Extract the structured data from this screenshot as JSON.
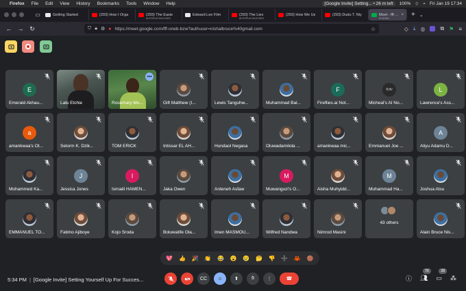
{
  "menubar": {
    "app": "Firefox",
    "items": [
      "File",
      "Edit",
      "View",
      "History",
      "Bookmarks",
      "Tools",
      "Window",
      "Help"
    ],
    "notification": "[Google Invite] Setting... • 26 m left",
    "battery": "100%",
    "datetime": "Fri Jan 19  17:34"
  },
  "tabs": [
    {
      "title": "Getting Started",
      "favicon": "doc-icon"
    },
    {
      "title": "(293) How I Orga",
      "favicon": "youtube-icon"
    },
    {
      "title": "(293) The Easie",
      "favicon": "youtube-icon",
      "sub": "AUTOPLAY BLOCKED"
    },
    {
      "title": "Edward Lee Film",
      "favicon": "doc-icon"
    },
    {
      "title": "(293) The Lies",
      "favicon": "youtube-icon",
      "sub": "AUTOPLAY BLOCKED"
    },
    {
      "title": "(293) How We Us",
      "favicon": "youtube-icon"
    },
    {
      "title": "(293) Dudu T. Niy",
      "favicon": "youtube-icon"
    },
    {
      "title": "Meet - fff-oneb-",
      "favicon": "meet-icon",
      "sub": "PLAYING",
      "active": true
    }
  ],
  "navbar": {
    "url": "https://meet.google.com/fff-oneb-bzw?authuser=nishalbruce%40gmail.com"
  },
  "participants": [
    {
      "name": "Emerald Akhau...",
      "initial": "E",
      "color": "#1e6b4f"
    },
    {
      "name": "Lalu Etchie",
      "video": "v1"
    },
    {
      "name": "Rosemary Mo...",
      "video": "v2",
      "speaking": true
    },
    {
      "name": "Gift Matthew (I...",
      "photo": "photo"
    },
    {
      "name": "Lewis Tanguhw...",
      "photo": "photo2"
    },
    {
      "name": "Muhammad Bal...",
      "photo": "photo4"
    },
    {
      "name": "Fireflies.ai Not...",
      "initial": "F",
      "color": "#1a6b5a"
    },
    {
      "name": "Micheal's AI No...",
      "logo": "tl;dv"
    },
    {
      "name": "Lawrence's Ass...",
      "initial": "L",
      "color": "#7cb342"
    },
    {
      "name": "amankwaa's Ot...",
      "initial": "a",
      "color": "#e8590c"
    },
    {
      "name": "Selorm K. Dzik...",
      "photo": "photo3"
    },
    {
      "name": "TOM ERICK",
      "photo": "photo2"
    },
    {
      "name": "Intissar EL AH...",
      "photo": "photo3"
    },
    {
      "name": "Hundaol Negasa",
      "photo": "photo4"
    },
    {
      "name": "Oluwadamilola ...",
      "photo": "photo"
    },
    {
      "name": "amankwaa mic...",
      "photo": "photo2"
    },
    {
      "name": "Emmanuel Joe ...",
      "photo": "photo3"
    },
    {
      "name": "Aliyu Adamu D...",
      "initial": "A",
      "color": "#6d8396"
    },
    {
      "name": "Mohammed Ka...",
      "photo": "photo2"
    },
    {
      "name": "Jessica Jones",
      "initial": "J",
      "color": "#6d8396"
    },
    {
      "name": "Ismaël HAMEN...",
      "initial": "I",
      "color": "#d81b60"
    },
    {
      "name": "Jaka Owen",
      "photo": "photo"
    },
    {
      "name": "Anteneh Asfaw",
      "photo": "photo4"
    },
    {
      "name": "Muwanguzi's O...",
      "initial": "M",
      "color": "#d81b60"
    },
    {
      "name": "Aisha Muhyidd...",
      "photo": "photo3"
    },
    {
      "name": "Muhammad Ha...",
      "initial": "M",
      "color": "#6d8396"
    },
    {
      "name": "Joshua Atsu",
      "photo": "photo4"
    },
    {
      "name": "EMMANUEL TO...",
      "photo": "photo2"
    },
    {
      "name": "Fatimo Ajiboye",
      "photo": "photo3"
    },
    {
      "name": "Kojo Sroda",
      "photo": "photo"
    },
    {
      "name": "Boluwatife Ola...",
      "photo": "photo3"
    },
    {
      "name": "Imen MASMOU...",
      "photo": "photo4"
    },
    {
      "name": "Wilfred Nandwa",
      "photo": "photo2"
    },
    {
      "name": "Nimrod Masini",
      "photo": "photo"
    },
    {
      "name": "43 others",
      "others": true
    },
    {
      "name": "Alain Bruce Nis...",
      "photo": "photo4"
    }
  ],
  "reactions": [
    "💖",
    "👍",
    "🎉",
    "👏",
    "😂",
    "😮",
    "😢",
    "🤔",
    "👎",
    "➕",
    "🦀",
    "🟤"
  ],
  "bottombar": {
    "time": "5:34 PM",
    "meeting_title": "[Google Invite] Setting Yourself Up For Succes...",
    "people_count": "76",
    "chat_badge": "28"
  }
}
